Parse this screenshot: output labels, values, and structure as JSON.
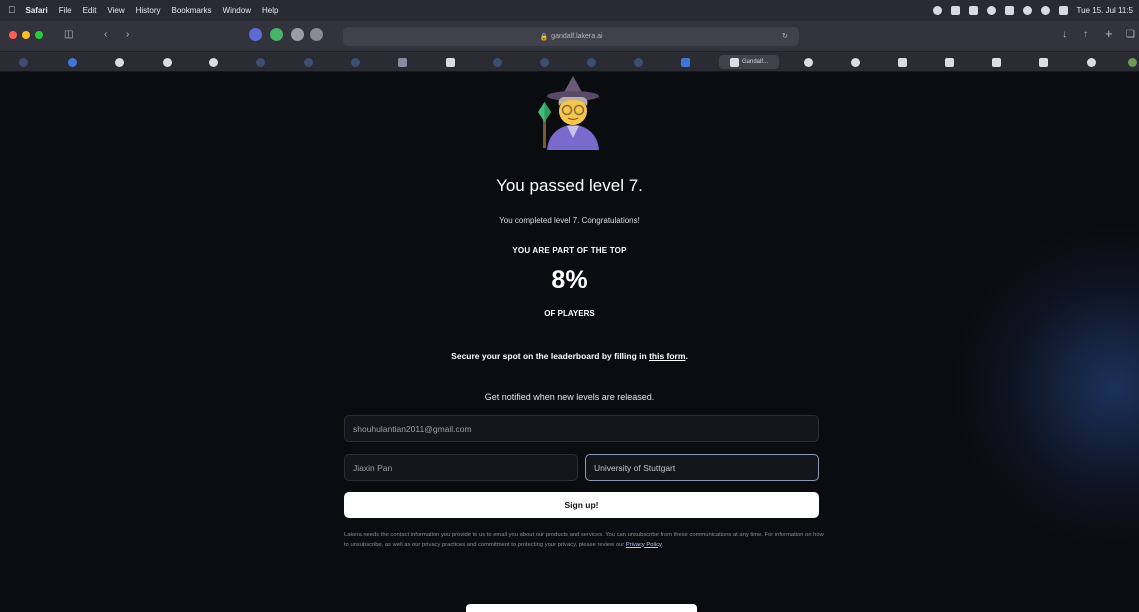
{
  "menubar": {
    "apple_icon": "apple-icon",
    "items": [
      "Safari",
      "File",
      "Edit",
      "View",
      "History",
      "Bookmarks",
      "Window",
      "Help"
    ],
    "clock": "Tue 15. Jul 11:5"
  },
  "toolbar": {
    "url": "gandalf.lakera.ai",
    "traffic_colors": [
      "#ff5f57",
      "#febc2e",
      "#28c840"
    ]
  },
  "tabs": {
    "active_label": "Gandalf..."
  },
  "page": {
    "title": "You passed level 7.",
    "subtitle": "You completed level 7. Congratulations!",
    "top_label": "YOU ARE PART OF THE TOP",
    "percent": "8%",
    "players_label": "OF PLAYERS",
    "secure_text": "Secure your spot on the leaderboard by filling in ",
    "secure_link": "this form",
    "secure_end": ".",
    "notified_text": "Get notified when new levels are released.",
    "form": {
      "email_value": "shouhulantian2011@gmail.com",
      "name_value": "Jiaxin Pan",
      "org_value": "University of Stuttgart",
      "signup_label": "Sign up!"
    },
    "disclaimer": "Lakera needs the contact information you provide to us to email you about our products and services. You can unsubscribe from these communications at any time. For information on how to unsubscribe, as well as our privacy practices and commitment to protecting your privacy, please review our ",
    "privacy_link": "Privacy Policy",
    "disclaimer_end": "."
  }
}
